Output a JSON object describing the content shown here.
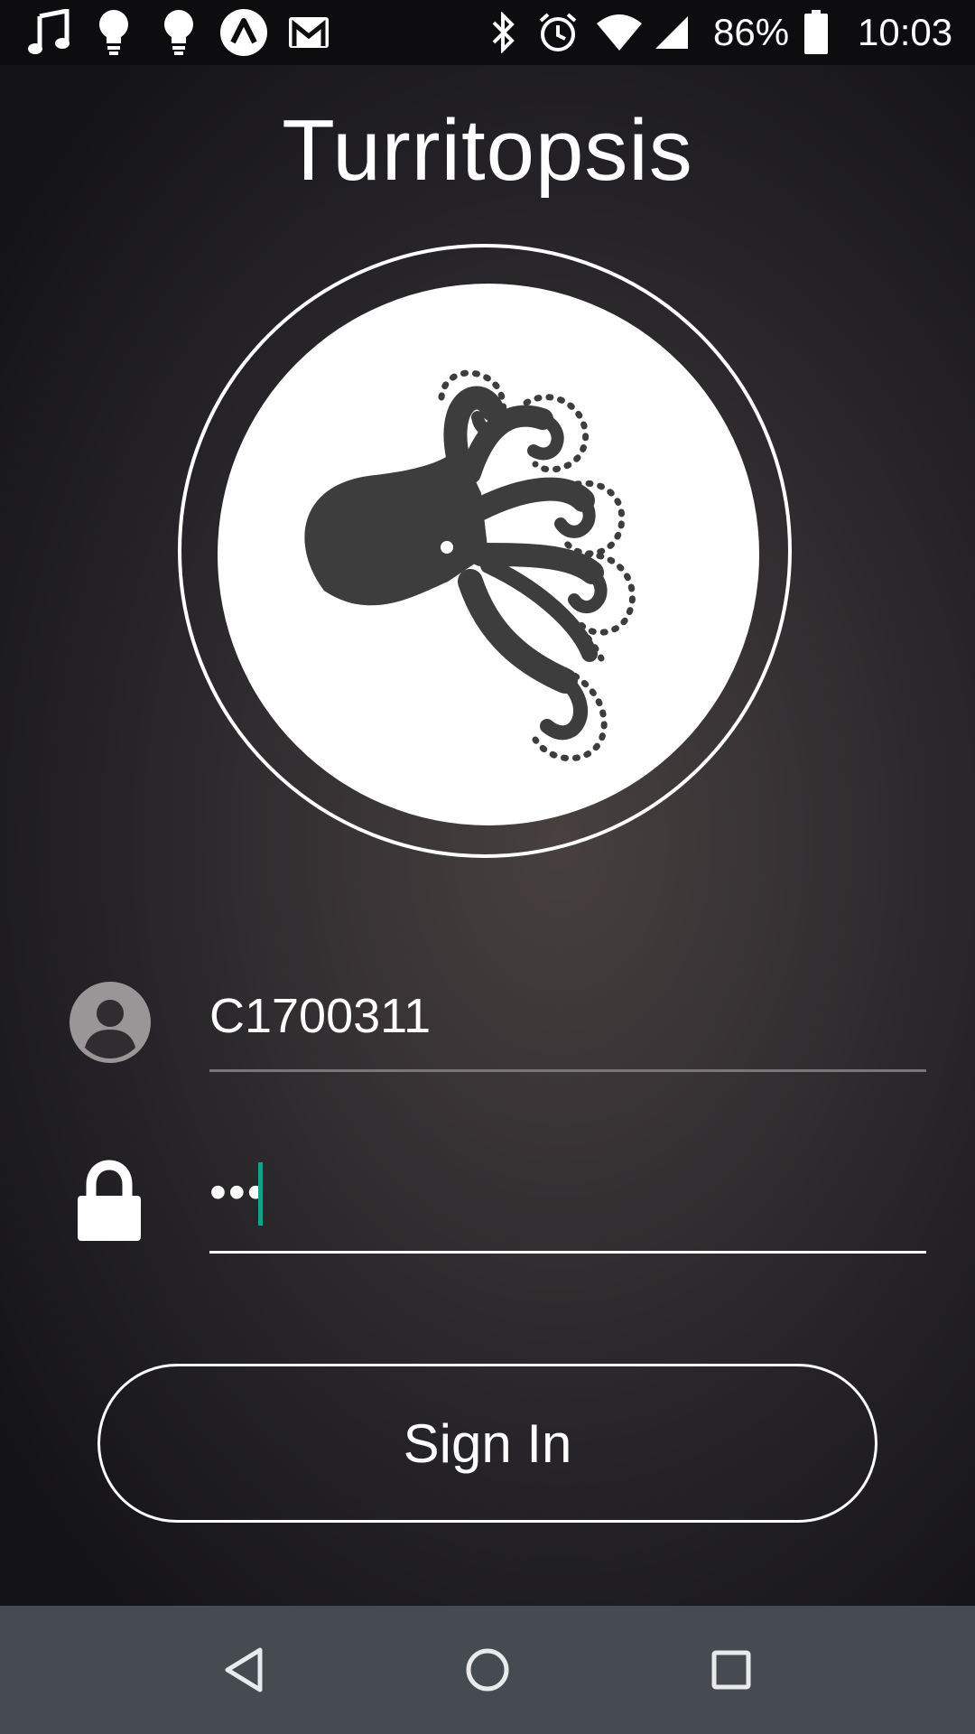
{
  "status_bar": {
    "icons": [
      "music-note-icon",
      "lightbulb-icon",
      "lightbulb-icon",
      "assistant-icon",
      "gmail-icon",
      "bluetooth-icon",
      "alarm-icon",
      "wifi-icon",
      "cell-signal-icon",
      "battery-icon"
    ],
    "battery_percent": "86%",
    "time": "10:03"
  },
  "app": {
    "title": "Turritopsis",
    "logo": "octopus-logo"
  },
  "login_form": {
    "username_value": "C1700311",
    "password_value": "•••",
    "username_icon": "user-avatar-icon",
    "password_icon": "lock-icon",
    "signin_label": "Sign In"
  },
  "nav_bar": {
    "buttons": [
      "back-icon",
      "home-icon",
      "recents-icon"
    ]
  },
  "colors": {
    "accent_caret": "#13a08c",
    "nav_bar_bg": "#454b51",
    "status_bar_bg": "#0d0d10"
  }
}
